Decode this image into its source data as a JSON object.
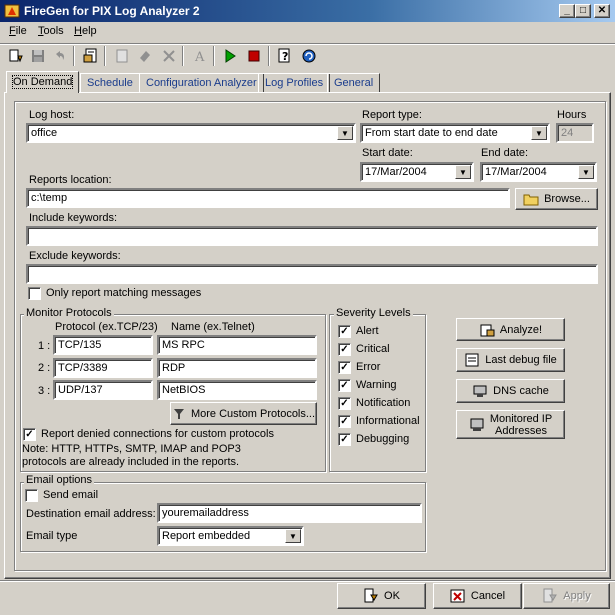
{
  "window": {
    "title": "FireGen for PIX Log Analyzer 2"
  },
  "menu": [
    {
      "label": "File",
      "u": "F",
      "rest": "ile"
    },
    {
      "label": "Tools",
      "u": "T",
      "rest": "ools"
    },
    {
      "label": "Help",
      "u": "H",
      "rest": "elp"
    }
  ],
  "toolbar": {
    "icons": [
      "open-log-icon",
      "save-icon",
      "undo-icon",
      "report-icon",
      "new-page-icon",
      "erase-icon",
      "delete-icon",
      "font-icon",
      "run-icon",
      "stop-icon",
      "help-icon",
      "refresh-icon"
    ]
  },
  "tabs": [
    "On Demand",
    "Schedule",
    "Configuration Analyzer",
    "Log Profiles",
    "General"
  ],
  "form": {
    "log_host_label": "Log host:",
    "log_host_value": "office",
    "report_type_label": "Report type:",
    "report_type_value": "From start date to end date",
    "hours_label": "Hours",
    "hours_value": "24",
    "start_date_label": "Start date:",
    "start_date_value": "17/Mar/2004",
    "end_date_label": "End date:",
    "end_date_value": "17/Mar/2004",
    "reports_location_label": "Reports location:",
    "reports_location_value": "c:\\temp",
    "browse_label": "Browse...",
    "include_keywords_label": "Include keywords:",
    "include_keywords_value": "",
    "exclude_keywords_label": "Exclude keywords:",
    "exclude_keywords_value": "",
    "only_matching_label": "Only report matching messages",
    "only_matching_checked": false
  },
  "protocols": {
    "group_title": "Monitor Protocols",
    "protocol_header": "Protocol (ex.TCP/23)",
    "name_header": "Name (ex.Telnet)",
    "rows": [
      {
        "num": "1 :",
        "protocol": "TCP/135",
        "name": "MS RPC"
      },
      {
        "num": "2 :",
        "protocol": "TCP/3389",
        "name": "RDP"
      },
      {
        "num": "3 :",
        "protocol": "UDP/137",
        "name": "NetBIOS"
      }
    ],
    "more_button": "More Custom Protocols...",
    "report_denied_label": "Report denied connections for custom protocols",
    "report_denied_checked": true,
    "note_line1": "Note: HTTP, HTTPs, SMTP, IMAP and POP3",
    "note_line2": "protocols are already included in the reports."
  },
  "severity": {
    "group_title": "Severity Levels",
    "levels": [
      {
        "label": "Alert",
        "checked": true
      },
      {
        "label": "Critical",
        "checked": true
      },
      {
        "label": "Error",
        "checked": true
      },
      {
        "label": "Warning",
        "checked": true
      },
      {
        "label": "Notification",
        "checked": true
      },
      {
        "label": "Informational",
        "checked": true
      },
      {
        "label": "Debugging",
        "checked": true
      }
    ]
  },
  "actions": {
    "analyze": "Analyze!",
    "last_debug": "Last debug file",
    "dns_cache": "DNS cache",
    "monitored_ip_1": "Monitored IP",
    "monitored_ip_2": "Addresses"
  },
  "email": {
    "group_title": "Email options",
    "send_email_label": "Send email",
    "send_email_checked": false,
    "destination_label": "Destination email address:",
    "destination_value": "youremailaddress",
    "type_label": "Email type",
    "type_value": "Report embedded"
  },
  "dialog_buttons": {
    "ok": "OK",
    "cancel": "Cancel",
    "apply": "Apply"
  },
  "colors": {
    "title_start": "#0a246a",
    "title_end": "#a6caf0",
    "face": "#d4d0c8",
    "tab_text": "#1a3c8c"
  }
}
